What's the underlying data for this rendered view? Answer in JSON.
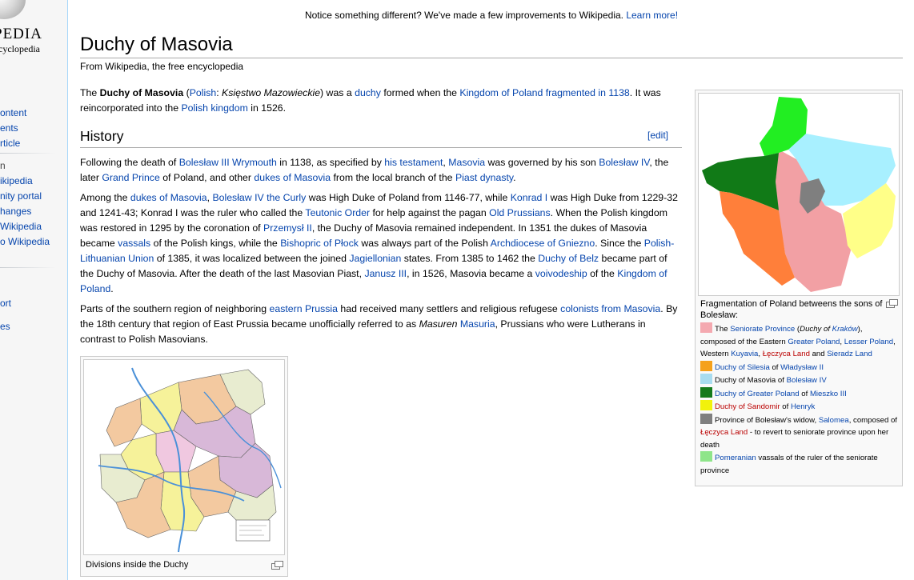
{
  "sidebar": {
    "logo_word": "WIKIPEDIA",
    "logo_visible": "PEDIA",
    "logo_tagline": "The Free Encyclopedia",
    "logo_tag_visible": "ncyclopedia",
    "nav_group1": [
      "ontent",
      "ents",
      "rticle"
    ],
    "nav_group2": [
      "n",
      "ikipedia",
      "nity portal",
      "hanges",
      "Wikipedia",
      "o Wikipedia"
    ],
    "nav_group3": [
      "ort"
    ],
    "nav_group4": [
      "es"
    ]
  },
  "sitenotice": {
    "text": "Notice something different? We've made a few improvements to Wikipedia. ",
    "link": "Learn more!"
  },
  "article": {
    "title": "Duchy of Masovia",
    "tagline": "From Wikipedia, the free encyclopedia",
    "intro": {
      "t1": "The ",
      "bold": "Duchy of Masovia",
      "t2": " (",
      "l1": "Polish",
      "t3": ": ",
      "ital": "Księstwo Mazowieckie",
      "t4": ") was a ",
      "l2": "duchy",
      "t5": " formed when the ",
      "l3": "Kingdom of Poland",
      "t6": " ",
      "l4": "fragmented in 1138",
      "t7": ". It was reincorporated into the ",
      "l5": "Polish kingdom",
      "t8": " in 1526."
    },
    "history_heading": "History",
    "edit_label": "[edit]",
    "p1": {
      "t1": "Following the death of ",
      "l1": "Bolesław III Wrymouth",
      "t2": " in 1138, as specified by ",
      "l2": "his testament",
      "t3": ", ",
      "l3": "Masovia",
      "t4": " was governed by his son ",
      "l4": "Bolesław IV",
      "t5": ", the later ",
      "l5": "Grand Prince",
      "t6": " of Poland, and other ",
      "l6": "dukes of Masovia",
      "t7": " from the local branch of the ",
      "l7": "Piast dynasty",
      "t8": "."
    },
    "p2": {
      "t1": "Among the ",
      "l1": "dukes of Masovia",
      "t2": ", ",
      "l2": "Bolesław IV the Curly",
      "t3": " was High Duke of Poland from 1146-77, while ",
      "l3": "Konrad I",
      "t4": " was High Duke from 1229-32 and 1241-43; Konrad I was the ruler who called the ",
      "l4": "Teutonic Order",
      "t5": " for help against the pagan ",
      "l5": "Old Prussians",
      "t6": ". When the Polish kingdom was restored in 1295 by the coronation of ",
      "l6": "Przemysł II",
      "t7": ", the Duchy of Masovia remained independent. In 1351 the dukes of Masovia became ",
      "l7": "vassals",
      "t8": " of the Polish kings, while the ",
      "l8": "Bishopric of Płock",
      "t9": " was always part of the Polish ",
      "l9": "Archdiocese of Gniezno",
      "t10": ". Since the ",
      "l10": "Polish-Lithuanian Union",
      "t11": " of 1385, it was localized between the joined ",
      "l11": "Jagiellonian",
      "t12": " states. From 1385 to 1462 the ",
      "l12": "Duchy of Belz",
      "t13": " became part of the Duchy of Masovia. After the death of the last Masovian Piast, ",
      "l13": "Janusz III",
      "t14": ", in 1526, Masovia became a ",
      "l14": "voivodeship",
      "t15": " of the ",
      "l15": "Kingdom of Poland",
      "t16": "."
    },
    "p3": {
      "t1": "Parts of the southern region of neighboring ",
      "l1": "eastern Prussia",
      "t2": " had received many settlers and religious refugese ",
      "l2": "colonists from Masovia",
      "t3": ". By the 18th century that region of East Prussia became unofficially referred to as ",
      "ital": "Masuren",
      "t4": " ",
      "l3": "Masuria",
      "t5": ", Prussians who were Lutherans in contrast to Polish Masovians."
    }
  },
  "thumb_left": {
    "caption": "Divisions inside the Duchy"
  },
  "thumb_right": {
    "caption": "Fragmentation of Poland betweens the sons of Bolesław:",
    "legend": [
      {
        "color": "#f4a9b0",
        "parts": [
          {
            "t": "The "
          },
          {
            "l": "Seniorate Province"
          },
          {
            "t": " ("
          },
          {
            "i": "Duchy of "
          },
          {
            "il": "Kraków"
          },
          {
            "t": "), composed of the Eastern "
          },
          {
            "l": "Greater Poland"
          },
          {
            "t": ", "
          },
          {
            "l": "Lesser Poland"
          },
          {
            "t": ", Western "
          },
          {
            "l": "Kuyavia"
          },
          {
            "t": ", "
          },
          {
            "r": "Łęczyca Land"
          },
          {
            "t": " and "
          },
          {
            "l": "Sieradz Land"
          }
        ]
      },
      {
        "color": "#f5a11c",
        "parts": [
          {
            "l": "Duchy of Silesia"
          },
          {
            "t": " of "
          },
          {
            "l": "Władysław II"
          }
        ]
      },
      {
        "color": "#a8dcef",
        "parts": [
          {
            "t": "Duchy of Masovia of "
          },
          {
            "l": "Bolesław IV"
          }
        ]
      },
      {
        "color": "#157a1c",
        "parts": [
          {
            "l": "Duchy of Greater Poland"
          },
          {
            "t": " of "
          },
          {
            "l": "Mieszko III"
          }
        ]
      },
      {
        "color": "#f2f20c",
        "parts": [
          {
            "r": "Duchy of Sandomir"
          },
          {
            "t": " of "
          },
          {
            "l": "Henryk"
          }
        ]
      },
      {
        "color": "#7f7f7f",
        "parts": [
          {
            "t": "Province of Bolesław's widow, "
          },
          {
            "l": "Salomea"
          },
          {
            "t": ", composed of "
          },
          {
            "r": "Łęczyca Land"
          },
          {
            "t": " - to revert to seniorate province upon her death"
          }
        ]
      },
      {
        "color": "#8fe58a",
        "parts": [
          {
            "l": "Pomeranian"
          },
          {
            "t": " vassals of the ruler of the seniorate province"
          }
        ]
      }
    ]
  },
  "colors": {
    "link": "#0645ad",
    "redlink": "#ba0000",
    "map_green_bright": "#22ee22",
    "map_cyan": "#a8f0ff",
    "map_dark_green": "#117a17",
    "map_orange": "#ff7f3a",
    "map_pink": "#f2a0a4",
    "map_yellow": "#ffff88",
    "map_gray": "#7f7f7f"
  }
}
